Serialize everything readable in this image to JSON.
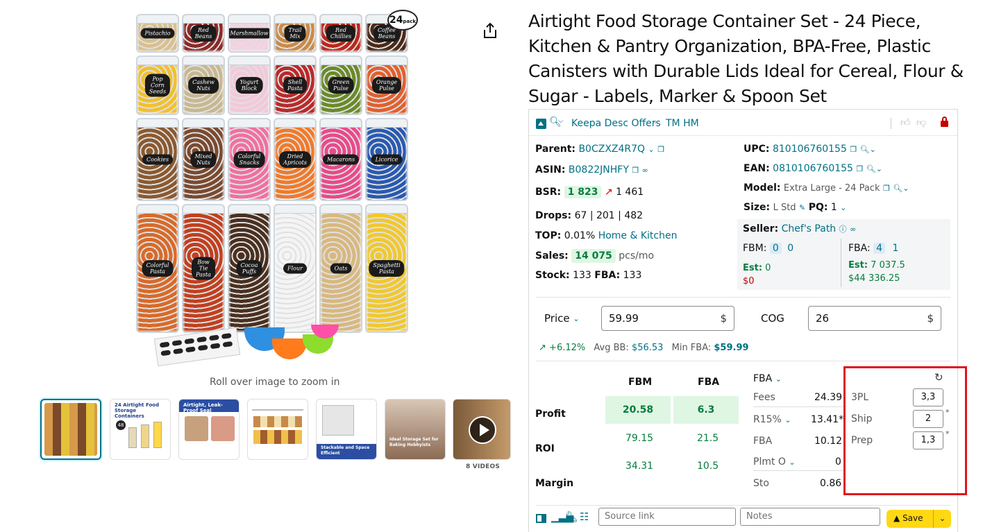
{
  "product": {
    "title": "Airtight Food Storage Container Set - 24 Piece, Kitchen & Pantry Organization, BPA-Free, Plastic Canisters with Durable Lids Ideal for Cereal, Flour & Sugar - Labels, Marker & Spoon Set",
    "zoom_hint": "Roll over image to zoom in",
    "badge": "24",
    "badge_sub": "pack",
    "videos_label": "8 VIDEOS",
    "jar_labels": [
      "Pistachio",
      "Red\nBeans",
      "Marshmallow",
      "Trail\nMix",
      "Red\nChillies",
      "Coffee\nBeans",
      "Pop Corn\nSeeds",
      "Cashew\nNuts",
      "Yogurt\nBlock",
      "Shell\nPasta",
      "Green\nPulse",
      "Orange\nPulse",
      "Cookies",
      "Mixed\nNuts",
      "Colorful\nSnacks",
      "Dried\nApricots",
      "Macarons",
      "Licorice",
      "Colorful\nPasta",
      "Bow Tie\nPasta",
      "Cocoa\nPuffs",
      "Flour",
      "Oats",
      "Spaghetti\nPasta"
    ],
    "thumbs": [
      {
        "title": ""
      },
      {
        "title": "24 Airtight Food Storage Containers",
        "sub": "48"
      },
      {
        "title": "Airtight, Leak-Proof Seal"
      },
      {
        "title": ""
      },
      {
        "title": "Stackable and Space Efficient"
      },
      {
        "title": "Ideal Storage Set for Baking Hobbyists"
      },
      {
        "title": ""
      }
    ]
  },
  "keepa": {
    "header": {
      "offers_label": "Keepa Desc Offers",
      "tm_label": "TM HM"
    },
    "left": {
      "parent_label": "Parent:",
      "parent_value": "B0CZXZ4R7Q",
      "asin_label": "ASIN:",
      "asin_value": "B0822JNHFY",
      "bsr_label": "BSR:",
      "bsr_value": "1 823",
      "bsr_prev": "1 461",
      "drops_label": "Drops:",
      "drops_value": "67 | 201 | 482",
      "top_label": "TOP:",
      "top_pct": "0.01%",
      "top_cat": "Home & Kitchen",
      "sales_label": "Sales:",
      "sales_value": "14 075",
      "sales_unit": "pcs/mo",
      "stock_label": "Stock:",
      "stock_value": "133",
      "stock_fba_label": "FBA:",
      "stock_fba_value": "133"
    },
    "right": {
      "upc_label": "UPC:",
      "upc_value": "810106760155",
      "ean_label": "EAN:",
      "ean_value": "0810106760155",
      "model_label": "Model:",
      "model_value": "Extra Large - 24 Pack",
      "size_label": "Size:",
      "size_value": "L Std",
      "pq_label": "PQ:",
      "pq_value": "1",
      "seller_label": "Seller:",
      "seller_value": "Chef's Path",
      "fbm_label": "FBM:",
      "fbm_count": "0",
      "fbm_count2": "0",
      "fba_label": "FBA:",
      "fba_count": "4",
      "fba_count2": "1",
      "est_label": "Est:",
      "fbm_est": "0",
      "fbm_money": "$0",
      "fba_est": "7 037.5",
      "fba_money": "$44 336.25"
    },
    "pricing": {
      "price_label": "Price",
      "price_value": "59.99",
      "currency": "$",
      "cog_label": "COG",
      "cog_value": "26",
      "change": "+6.12%",
      "avg_bb_label": "Avg BB:",
      "avg_bb_value": "$56.53",
      "min_fba_label": "Min FBA:",
      "min_fba_value": "$59.99"
    },
    "metrics": {
      "col_fbm": "FBM",
      "col_fba": "FBA",
      "profit_label": "Profit",
      "profit_fbm": "20.58",
      "profit_fba": "6.3",
      "roi_label": "ROI",
      "roi_fbm": "79.15",
      "roi_fba": "21.5",
      "margin_label": "Margin",
      "margin_fbm": "34.31",
      "margin_fba": "10.5"
    },
    "fees": {
      "mode_label": "FBA",
      "fees_label": "Fees",
      "fees_value": "24.39",
      "r15_label": "R15%",
      "r15_value": "13.41*",
      "fba_label": "FBA",
      "fba_value": "10.12",
      "plmt_label": "Plmt O",
      "plmt_value": "0",
      "sto_label": "Sto",
      "sto_value": "0.86"
    },
    "extras": {
      "tpl_label": "3PL",
      "tpl_value": "3,3",
      "ship_label": "Ship",
      "ship_value": "2",
      "prep_label": "Prep",
      "prep_value": "1,3",
      "asterisk": "*"
    },
    "footer": {
      "source_placeholder": "Source link",
      "notes_placeholder": "Notes",
      "save_label": "Save"
    }
  },
  "colors": {
    "accent": "#007185",
    "green": "#067d3e",
    "highlight_red": "#e0141e",
    "save_yellow": "#ffd814"
  }
}
